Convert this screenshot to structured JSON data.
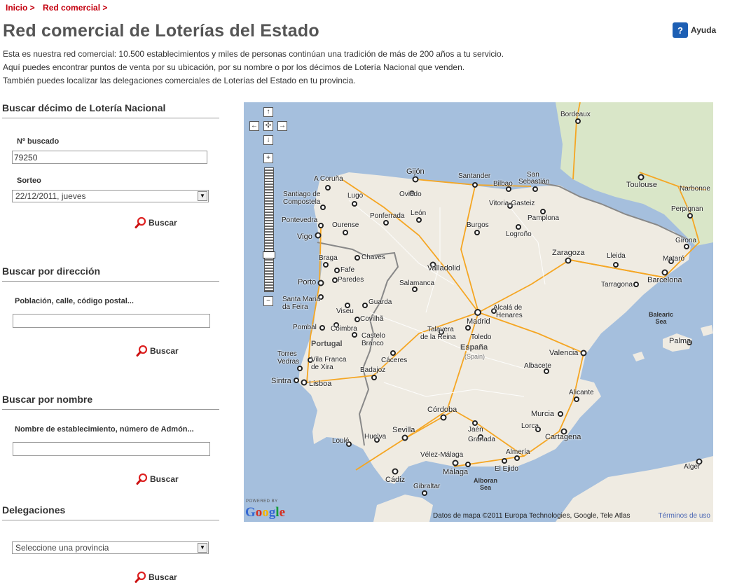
{
  "breadcrumb": {
    "items": [
      "Inicio >",
      "Red comercial >"
    ]
  },
  "title": "Red comercial de Loterías del Estado",
  "help": {
    "label": "Ayuda",
    "icon": "question-icon"
  },
  "intro": [
    "Esta es nuestra red comercial: 10.500 establecimientos y miles de personas continúan una tradición de más de 200 años a tu servicio.",
    "Aquí puedes encontrar puntos de venta por su ubicación, por su nombre o por los décimos de Lotería Nacional que venden.",
    "También puedes localizar las delegaciones comerciales de Loterías del Estado en tu provincia."
  ],
  "decimo": {
    "heading": "Buscar décimo de Lotería Nacional",
    "number_label": "Nº buscado",
    "number_value": "79250",
    "draw_label": "Sorteo",
    "draw_value": "22/12/2011, jueves",
    "search_label": "Buscar"
  },
  "direccion": {
    "heading": "Buscar por dirección",
    "field_label": "Población, calle, código postal...",
    "field_value": "",
    "search_label": "Buscar"
  },
  "nombre": {
    "heading": "Buscar por nombre",
    "field_label": "Nombre de establecimiento, número de Admón...",
    "field_value": "",
    "search_label": "Buscar"
  },
  "delegaciones": {
    "heading": "Delegaciones",
    "select_value": "Seleccione una provincia",
    "search_label": "Buscar"
  },
  "map": {
    "powered": "POWERED BY",
    "logo": [
      "G",
      "o",
      "o",
      "g",
      "l",
      "e"
    ],
    "copyright": "Datos de mapa ©2011 Europa Technologies, Google, Tele Atlas",
    "terms": "Términos de uso",
    "controls": {
      "up": "↑",
      "left": "←",
      "center": "✣",
      "right": "→",
      "down": "↓",
      "zoom_in": "+",
      "zoom_out": "−"
    },
    "colors": {
      "sea": "#a5bfdd",
      "land": "#efebe2",
      "highway": "#f5a623",
      "border": "#777777"
    },
    "countries": [
      "España",
      "(Spain)",
      "Portugal"
    ],
    "seas": [
      "Balearic",
      "Sea",
      "Alboran",
      "Sea"
    ],
    "cities": [
      "Bordeaux",
      "Gijón",
      "Santander",
      "Bilbao",
      "San",
      "Sebastián",
      "Toulouse",
      "Narbonne",
      "Perpignan",
      "A Coruña",
      "Santiago de",
      "Compostela",
      "Lugo",
      "Oviedo",
      "Vitoria-Gasteiz",
      "Pamplona",
      "Logroño",
      "Ponferrada",
      "León",
      "Burgos",
      "Pontevedra",
      "Ourense",
      "Vigo",
      "Zaragoza",
      "Lleida",
      "Girona",
      "Mataró",
      "Tarragona",
      "Barcelona",
      "Braga",
      "Chaves",
      "Valladolid",
      "Fafe",
      "Porto",
      "Paredes",
      "Salamanca",
      "Santa Maria",
      "da Feira",
      "Viseu",
      "Guarda",
      "Covilhã",
      "Madrid",
      "Alcalá de",
      "Henares",
      "Pombal",
      "Coimbra",
      "Castelo",
      "Branco",
      "Talavera",
      "de la Reina",
      "Toledo",
      "Torres",
      "Vedras",
      "Vila Franca",
      "de Xira",
      "Cáceres",
      "Valencia",
      "Palma",
      "Sintra",
      "Lisboa",
      "Badajoz",
      "Albacete",
      "Alicante",
      "Córdoba",
      "Murcia",
      "Lorca",
      "Cartagena",
      "Jaén",
      "Sevilla",
      "Granada",
      "Huelva",
      "Loulé",
      "Almería",
      "Vélez-Málaga",
      "Málaga",
      "El Ejido",
      "Cádiz",
      "Gibraltar",
      "Alger"
    ]
  }
}
